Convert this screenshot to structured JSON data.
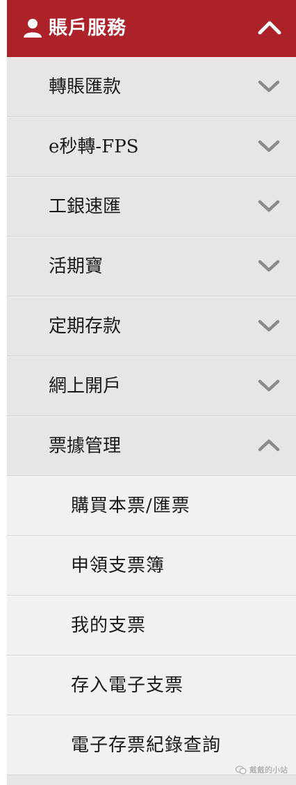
{
  "header": {
    "title": "賬戶服務",
    "icon": "user-icon",
    "expanded": true,
    "color": "#ad2129"
  },
  "items": [
    {
      "label": "轉賬匯款",
      "expanded": false
    },
    {
      "label": "e秒轉-FPS",
      "expanded": false
    },
    {
      "label": "工銀速匯",
      "expanded": false
    },
    {
      "label": "活期寶",
      "expanded": false
    },
    {
      "label": "定期存款",
      "expanded": false
    },
    {
      "label": "網上開戶",
      "expanded": false
    },
    {
      "label": "票據管理",
      "expanded": true
    }
  ],
  "subitems": [
    {
      "label": "購買本票/匯票"
    },
    {
      "label": "申領支票簿"
    },
    {
      "label": "我的支票"
    },
    {
      "label": "存入電子支票"
    },
    {
      "label": "電子存票紀錄查詢"
    }
  ],
  "watermark": {
    "text": "戴戴的小站",
    "icon": "wechat-icon"
  }
}
